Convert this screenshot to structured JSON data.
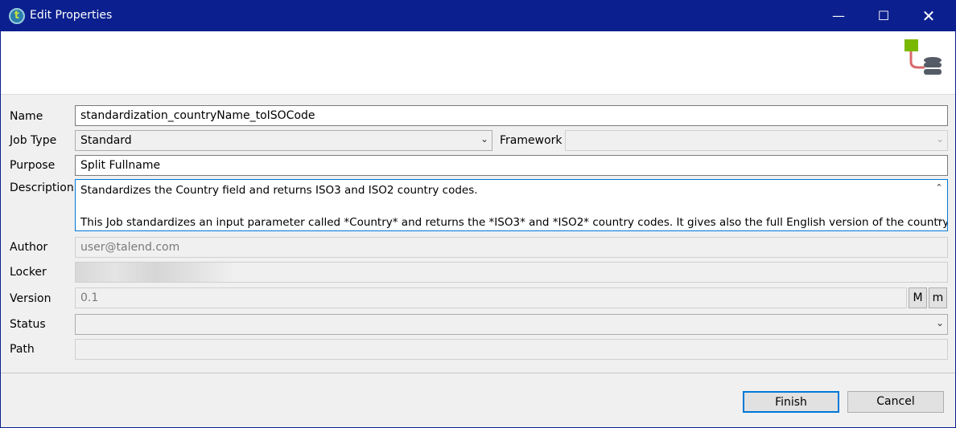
{
  "window": {
    "title": "Edit Properties"
  },
  "form": {
    "name_label": "Name",
    "name_value": "standardization_countryName_toISOCode",
    "jobtype_label": "Job Type",
    "jobtype_value": "Standard",
    "framework_label": "Framework",
    "framework_value": "",
    "purpose_label": "Purpose",
    "purpose_value": "Split Fullname",
    "description_label": "Description",
    "description_line1": "Standardizes the Country field and returns ISO3 and ISO2 country codes.",
    "description_line2": "This Job standardizes an input parameter called *Country* and returns the *ISO3* and *ISO2* country codes. It gives also the full English version of the country.",
    "author_label": "Author",
    "author_value": "user@talend.com",
    "locker_label": "Locker",
    "version_label": "Version",
    "version_value": "0.1",
    "major_label": "M",
    "minor_label": "m",
    "status_label": "Status",
    "path_label": "Path"
  },
  "buttons": {
    "finish": "Finish",
    "cancel": "Cancel"
  }
}
